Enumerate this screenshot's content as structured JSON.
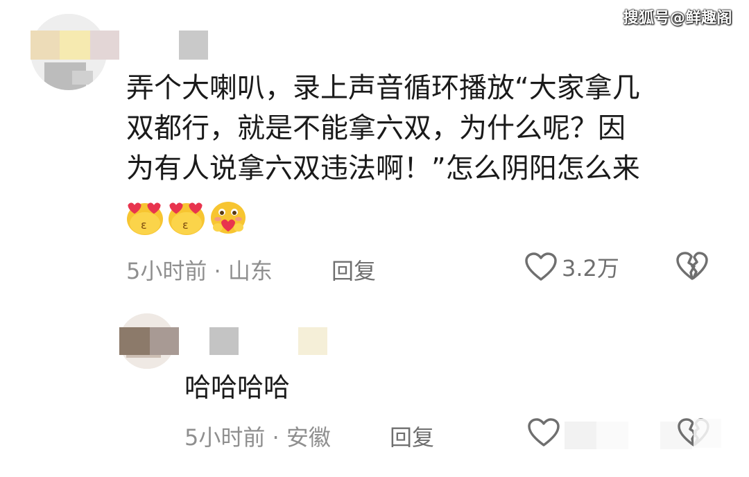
{
  "watermark": "搜狐号@鲜趣阁",
  "main_comment": {
    "text_lines": [
      "弄个大喇叭，录上声音循环播放“大家拿几",
      "双都行，就是不能拿六双，为什么呢？因",
      "为有人说拿六双违法啊！”怎么阴阳怎么来"
    ],
    "emojis": [
      "heart-eyes-kiss",
      "heart-eyes-kiss",
      "hug-heart"
    ],
    "time_location": "5小时前 · 山东",
    "reply_label": "回复",
    "likes": "3.2万"
  },
  "reply_comment": {
    "text": "哈哈哈哈",
    "time_location": "5小时前 · 安徽",
    "reply_label": "回复"
  },
  "colors": {
    "meta_gray": "#8f8f8f",
    "icon_gray": "#6f6f6f",
    "emoji_yellow": "#f7c531",
    "emoji_heart": "#e8344e"
  }
}
